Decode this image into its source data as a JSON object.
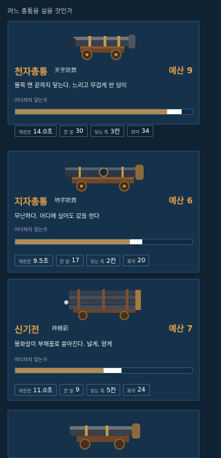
{
  "page": {
    "title": "어느 총통을 실을 것인가"
  },
  "cards": [
    {
      "name": "천자총통",
      "hanja": "天字銃筒",
      "budget": "예산 9",
      "desc": "물목 맨 끝까지 닿는다. 느리고 무겁게 한 덩이",
      "reach_label": "어디까지 닿는가",
      "reach_fraction": 0.96,
      "stats": [
        {
          "label": "재장전",
          "value": "14.0초"
        },
        {
          "label": "한 발",
          "value": "30"
        },
        {
          "label": "닿는 폭",
          "value": "3칸"
        },
        {
          "label": "화약",
          "value": "34"
        }
      ],
      "icon": "cannon-icon"
    },
    {
      "name": "지자총통",
      "hanja": "地字銃筒",
      "budget": "예산 6",
      "desc": "무난하다. 어디에 실어도 값을 한다",
      "reach_label": "어디까지 닿는가",
      "reach_fraction": 0.72,
      "stats": [
        {
          "label": "재장전",
          "value": "9.5초"
        },
        {
          "label": "한 발",
          "value": "17"
        },
        {
          "label": "닿는 폭",
          "value": "2칸"
        },
        {
          "label": "화약",
          "value": "20"
        }
      ],
      "icon": "cannon-icon"
    },
    {
      "name": "신기전",
      "hanja": "神機箭",
      "budget": "예산 7",
      "desc": "불화살이 부채꼴로 쏟아진다. 넓게, 얕게",
      "reach_label": "어디까지 닿는가",
      "reach_fraction": 0.6,
      "stats": [
        {
          "label": "재장전",
          "value": "11.0초"
        },
        {
          "label": "한 발",
          "value": "9"
        },
        {
          "label": "닿는 폭",
          "value": "5칸"
        },
        {
          "label": "화약",
          "value": "24"
        }
      ],
      "icon": "rocket-launcher-icon"
    }
  ]
}
